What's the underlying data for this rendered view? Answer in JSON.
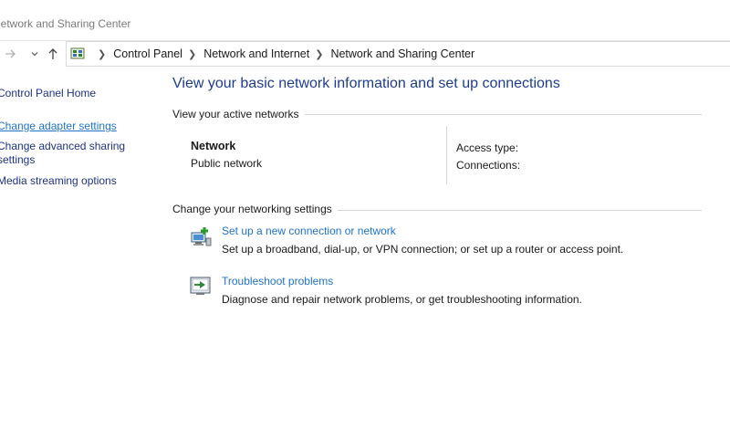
{
  "window": {
    "title": "Network and Sharing Center"
  },
  "nav": {
    "breadcrumbs": [
      "Control Panel",
      "Network and Internet",
      "Network and Sharing Center"
    ]
  },
  "sidebar": {
    "items": [
      {
        "label": "Control Panel Home"
      },
      {
        "label": "Change adapter settings"
      },
      {
        "label": "Change advanced sharing settings"
      },
      {
        "label": "Media streaming options"
      }
    ]
  },
  "main": {
    "heading": "View your basic network information and set up connections",
    "active_networks_label": "View your active networks",
    "network": {
      "name": "Network",
      "type": "Public network",
      "access_type_label": "Access type:",
      "connections_label": "Connections:"
    },
    "change_settings_label": "Change your networking settings",
    "tasks": [
      {
        "link": "Set up a new connection or network",
        "description": "Set up a broadband, dial-up, or VPN connection; or set up a router or access point.",
        "icon": "network-setup-icon"
      },
      {
        "link": "Troubleshoot problems",
        "description": "Diagnose and repair network problems, or get troubleshooting information.",
        "icon": "troubleshoot-icon"
      }
    ]
  },
  "colors": {
    "link": "#1e73c8",
    "heading": "#1e3c8c",
    "sidebar_link": "#1e3287"
  }
}
